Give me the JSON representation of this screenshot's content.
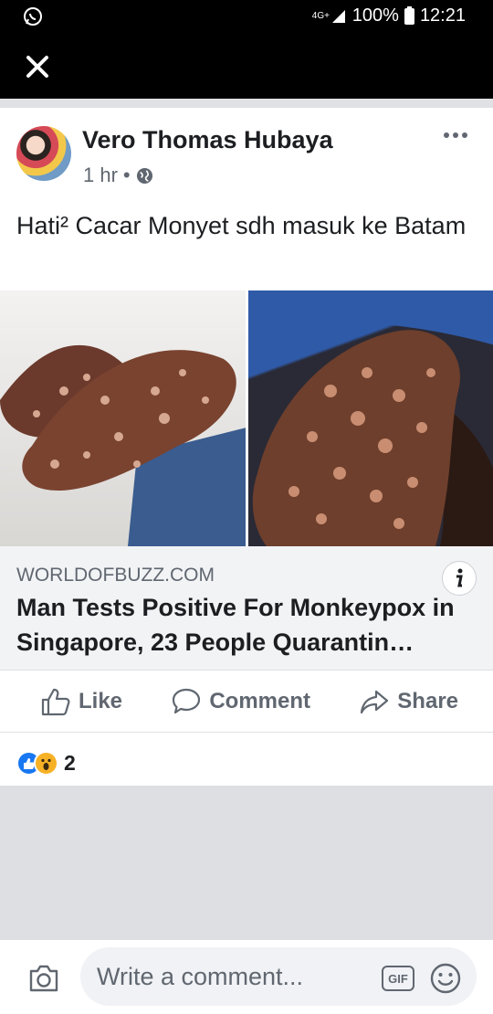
{
  "status_bar": {
    "network": "4G+",
    "battery": "100%",
    "time": "12:21"
  },
  "post": {
    "author": "Vero Thomas Hubaya",
    "time": "1 hr",
    "separator": "•",
    "text": "Hati² Cacar Monyet sdh masuk ke Batam",
    "link": {
      "domain": "WORLDOFBUZZ.COM",
      "title": "Man Tests Positive For Monkeypox in Singapore, 23 People Quarantin…"
    },
    "actions": {
      "like": "Like",
      "comment": "Comment",
      "share": "Share"
    },
    "reactions": {
      "count": "2"
    }
  },
  "composer": {
    "placeholder": "Write a comment...",
    "gif": "GIF"
  },
  "colors": {
    "brand_blue": "#1877f2",
    "wow_yellow": "#f7b125",
    "text_primary": "#1c1e21",
    "text_secondary": "#606770"
  }
}
